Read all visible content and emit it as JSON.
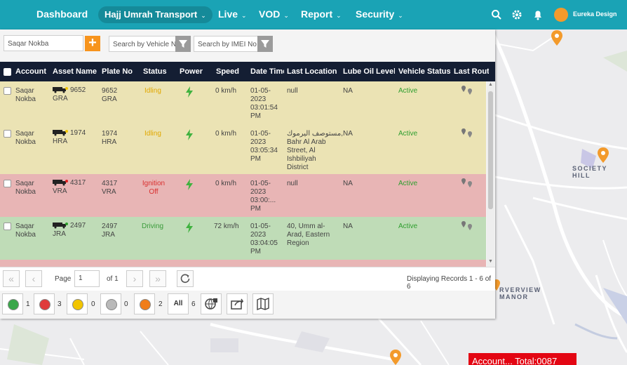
{
  "nav": {
    "dashboard": "Dashboard",
    "hajj": "Hajj Umrah Transport",
    "live": "Live",
    "vod": "VOD",
    "report": "Report",
    "security": "Security",
    "brand": "Eureka Design"
  },
  "filters": {
    "account_value": "Saqar Nokba",
    "vehicle_placeholder": "Search by Vehicle N",
    "imei_placeholder": "Search by IMEI No"
  },
  "table": {
    "headers": [
      "Account",
      "Asset Name",
      "Plate No",
      "Status",
      "Power",
      "Speed",
      "Date Time",
      "Last Location",
      "Lube Oil Level",
      "Vehicle Status",
      "Last Route"
    ],
    "rows": [
      {
        "account1": "Saqar",
        "account2": "Nokba",
        "asset_num": "9652",
        "asset_code": "GRA",
        "plate1": "9652",
        "plate2": "GRA",
        "status1": "Idling",
        "status2": "",
        "speed": "0 km/h",
        "dt1": "01-05-",
        "dt2": "2023",
        "dt3": "03:01:54",
        "dt4": "PM",
        "loc1": "null",
        "loc2": "",
        "loc3": "",
        "loc4": "",
        "lube": "NA",
        "vstatus": "Active"
      },
      {
        "account1": "Saqar",
        "account2": "Nokba",
        "asset_num": "1974",
        "asset_code": "HRA",
        "plate1": "1974",
        "plate2": "HRA",
        "status1": "Idling",
        "status2": "",
        "speed": "0 km/h",
        "dt1": "01-05-",
        "dt2": "2023",
        "dt3": "03:05:34",
        "dt4": "PM",
        "loc1": "مستوصف اليرموك,",
        "loc2": "Bahr Al Arab",
        "loc3": "Street, Al",
        "loc4": "Ishbiliyah",
        "loc5": "District",
        "lube": "NA",
        "vstatus": "Active"
      },
      {
        "account1": "Saqar",
        "account2": "Nokba",
        "asset_num": "4317",
        "asset_code": "VRA",
        "plate1": "4317",
        "plate2": "VRA",
        "status1": "Ignition",
        "status2": "Off",
        "speed": "0 km/h",
        "dt1": "01-05-",
        "dt2": "2023",
        "dt3": "03:00:...",
        "dt4": "PM",
        "loc1": "null",
        "loc2": "",
        "loc3": "",
        "loc4": "",
        "lube": "NA",
        "vstatus": "Active"
      },
      {
        "account1": "Saqar",
        "account2": "Nokba",
        "asset_num": "2497",
        "asset_code": "JRA",
        "plate1": "2497",
        "plate2": "JRA",
        "status1": "Driving",
        "status2": "",
        "speed": "72 km/h",
        "dt1": "01-05-",
        "dt2": "2023",
        "dt3": "03:04:05",
        "dt4": "PM",
        "loc1": "40, Umm al-",
        "loc2": "Arad, Eastern",
        "loc3": "Region",
        "loc4": "",
        "lube": "NA",
        "vstatus": "Active"
      }
    ]
  },
  "pager": {
    "page_label": "Page",
    "page_value": "1",
    "of_label": "of 1",
    "records": "Displaying Records 1 - 6 of 6"
  },
  "legend": {
    "green": "1",
    "red": "3",
    "yellow": "0",
    "grey": "0",
    "orange": "2",
    "all_label": "All",
    "all": "6"
  },
  "map": {
    "society_hill": "SOCIETY HILL",
    "riverview1": "RVERVIEW",
    "riverview2": "MANOR",
    "account_badge": "Account... Total:0087"
  },
  "colors": {
    "nav": "#1aa3b5",
    "idling_row": "#ebe3b4",
    "off_row": "#e8b5b5",
    "driving_row": "#bfdcb7",
    "marker": "#f39a2b"
  }
}
